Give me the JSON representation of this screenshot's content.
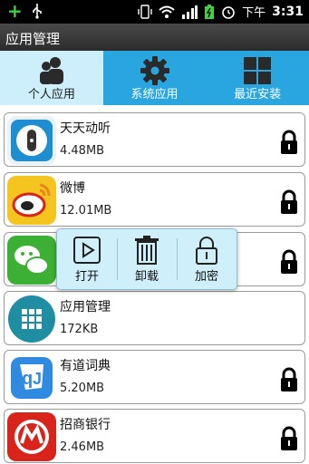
{
  "status_bar": {
    "period": "下午",
    "time": "3:31"
  },
  "title_bar": {
    "title": "应用管理"
  },
  "tabs": [
    {
      "label": "个人应用",
      "icon": "person-icon",
      "active": true
    },
    {
      "label": "系统应用",
      "icon": "gear-icon",
      "active": false
    },
    {
      "label": "最近安装",
      "icon": "grid-icon",
      "active": false
    }
  ],
  "apps": [
    {
      "name": "天天动听",
      "size": "4.48MB",
      "icon": "ttpod-icon",
      "locked": true
    },
    {
      "name": "微博",
      "size": "12.01MB",
      "icon": "weibo-icon",
      "locked": true
    },
    {
      "name": "",
      "size": "",
      "icon": "wechat-icon",
      "locked": true
    },
    {
      "name": "应用管理",
      "size": "172KB",
      "icon": "app-manager-icon",
      "locked": false
    },
    {
      "name": "有道词典",
      "size": "5.20MB",
      "icon": "youdao-icon",
      "locked": true
    },
    {
      "name": "招商银行",
      "size": "2.46MB",
      "icon": "cmb-icon",
      "locked": true
    }
  ],
  "popup": {
    "actions": [
      {
        "label": "打开",
        "icon": "play-icon"
      },
      {
        "label": "卸载",
        "icon": "trash-icon"
      },
      {
        "label": "加密",
        "icon": "lock-icon"
      }
    ]
  }
}
